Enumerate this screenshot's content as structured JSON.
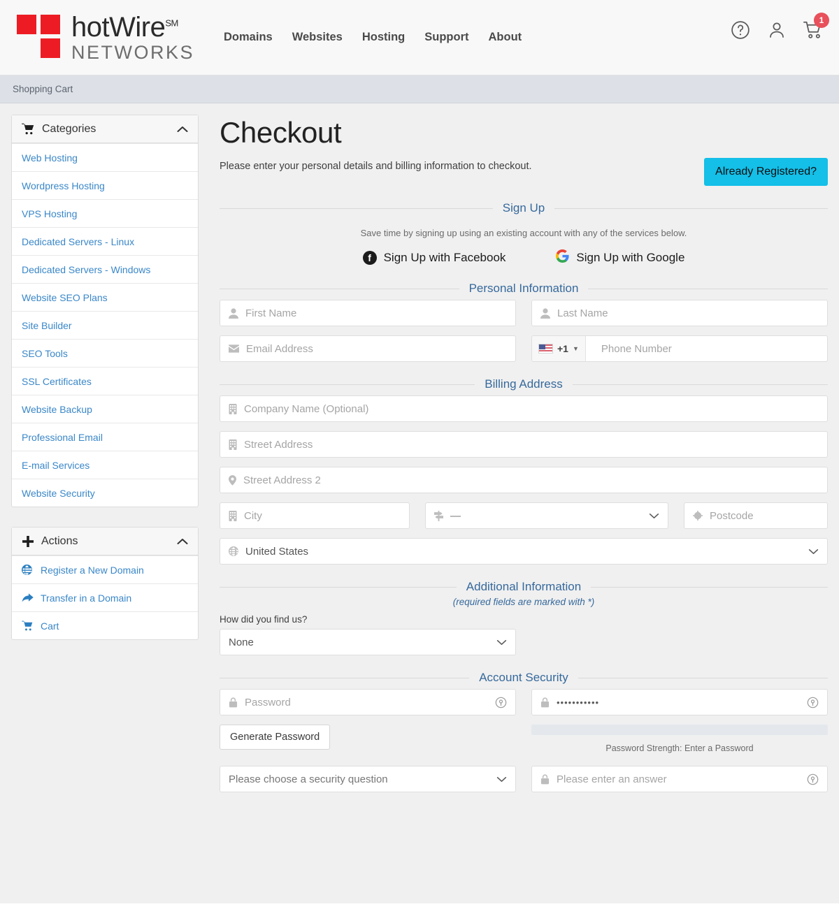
{
  "header": {
    "logo": {
      "top": "hotWire",
      "sm": "SM",
      "bottom": "NETWORKS"
    },
    "nav": [
      {
        "label": "Domains"
      },
      {
        "label": "Websites"
      },
      {
        "label": "Hosting"
      },
      {
        "label": "Support"
      },
      {
        "label": "About"
      }
    ],
    "icons": {
      "help": "help-circle-icon",
      "account": "user-icon",
      "cart": "cart-icon",
      "cart_badge": "1"
    }
  },
  "breadcrumb": {
    "current": "Shopping Cart"
  },
  "sidebar": {
    "categories": {
      "title": "Categories",
      "icon": "cart-icon",
      "collapse_icon": "chevron-up-icon",
      "items": [
        {
          "label": "Web Hosting"
        },
        {
          "label": "Wordpress Hosting"
        },
        {
          "label": "VPS Hosting"
        },
        {
          "label": "Dedicated Servers - Linux"
        },
        {
          "label": "Dedicated Servers - Windows"
        },
        {
          "label": "Website SEO Plans"
        },
        {
          "label": "Site Builder"
        },
        {
          "label": "SEO Tools"
        },
        {
          "label": "SSL Certificates"
        },
        {
          "label": "Website Backup"
        },
        {
          "label": "Professional Email"
        },
        {
          "label": "E-mail Services"
        },
        {
          "label": "Website Security"
        }
      ]
    },
    "actions": {
      "title": "Actions",
      "icon": "plus-icon",
      "collapse_icon": "chevron-up-icon",
      "items": [
        {
          "label": "Register a New Domain",
          "icon": "globe-icon"
        },
        {
          "label": "Transfer in a Domain",
          "icon": "arrow-share-icon"
        },
        {
          "label": "Cart",
          "icon": "cart-icon"
        }
      ]
    }
  },
  "main": {
    "title": "Checkout",
    "intro": "Please enter your personal details and billing information to checkout.",
    "already_registered_label": "Already Registered?",
    "signup": {
      "heading": "Sign Up",
      "note": "Save time by signing up using an existing account with any of the services below.",
      "facebook_label": "Sign Up with Facebook",
      "google_label": "Sign Up with Google"
    },
    "personal": {
      "heading": "Personal Information",
      "first_name_placeholder": "First Name",
      "last_name_placeholder": "Last Name",
      "email_placeholder": "Email Address",
      "phone_country_code": "+1",
      "phone_placeholder": "Phone Number"
    },
    "billing": {
      "heading": "Billing Address",
      "company_placeholder": "Company Name (Optional)",
      "street1_placeholder": "Street Address",
      "street2_placeholder": "Street Address 2",
      "city_placeholder": "City",
      "state_value": "—",
      "postcode_placeholder": "Postcode",
      "country_value": "United States"
    },
    "additional": {
      "heading": "Additional Information",
      "required_note": "(required fields are marked with *)",
      "how_find_label": "How did you find us?",
      "how_find_value": "None"
    },
    "security": {
      "heading": "Account Security",
      "password_placeholder": "Password",
      "confirm_value": "•••••••••••",
      "generate_label": "Generate Password",
      "strength_text": "Password Strength: Enter a Password",
      "question_placeholder": "Please choose a security question",
      "answer_placeholder": "Please enter an answer"
    }
  },
  "colors": {
    "brand_red": "#ed1c24",
    "accent_blue": "#14bfe8",
    "link_blue": "#3a87c8",
    "heading_blue": "#36699c",
    "badge_red": "#e8505b"
  }
}
